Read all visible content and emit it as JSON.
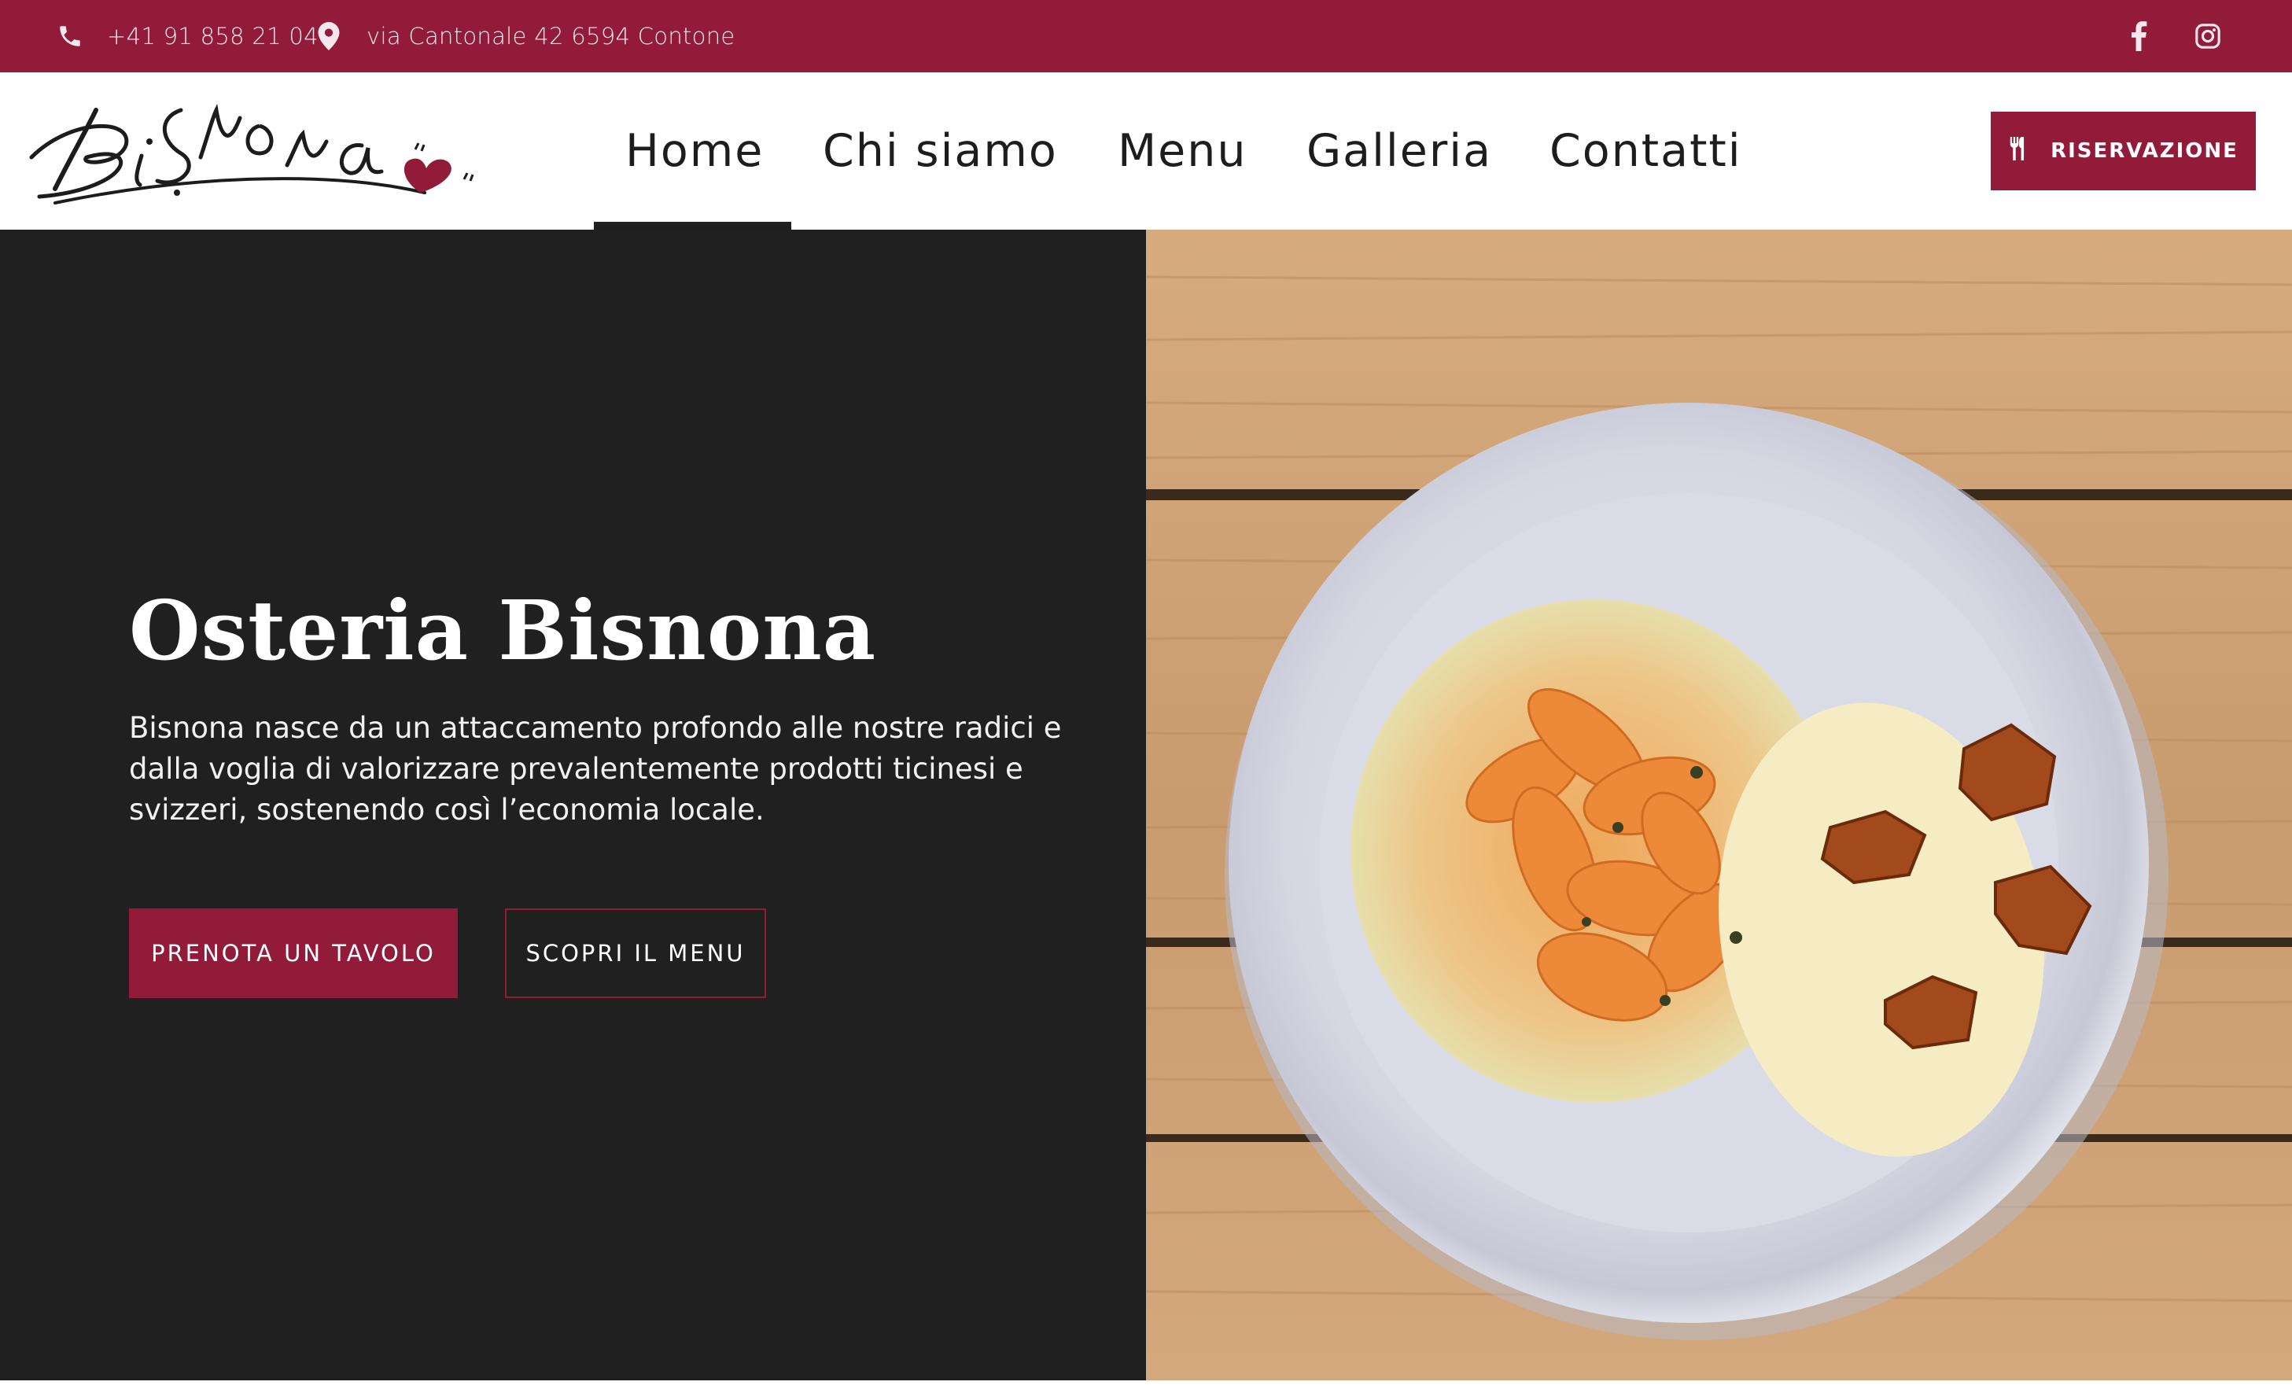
{
  "topbar": {
    "phone": "+41 91 858 21 04",
    "address": "via Cantonale 42 6594 Contone",
    "phone_icon": "phone-icon",
    "location_icon": "map-pin-icon",
    "social": [
      "facebook-icon",
      "instagram-icon"
    ]
  },
  "header": {
    "logo_text": "Bisnona",
    "nav": [
      "Home",
      "Chi siamo",
      "Menu",
      "Galleria",
      "Contatti"
    ],
    "active_nav": "Home",
    "reservation_label": "RISERVAZIONE",
    "reservation_icon": "utensils-icon"
  },
  "hero": {
    "title": "Osteria Bisnona",
    "description": "Bisnona nasce da un attaccamento profondo alle nostre radici e dalla voglia di valorizzare prevalentemente prodotti ticinesi e svizzeri, sostenendo così l’economia locale.",
    "primary_button": "PRENOTA UN TAVOLO",
    "secondary_button": "SCOPRI IL MENU"
  },
  "colors": {
    "brand": "#921b3a",
    "dark_panel": "#202021",
    "nav_text": "#1d1d1d",
    "wood": "#c99f74"
  }
}
